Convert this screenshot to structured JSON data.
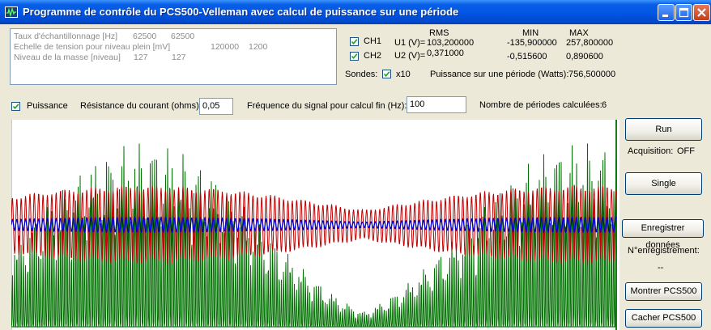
{
  "window": {
    "title": "Programme de contrôle du PCS500-Velleman avec calcul de puissance sur une période"
  },
  "info": {
    "rows": [
      {
        "label": "Taux d'échantillonnage [Hz]",
        "v1": "62500",
        "v2": "62500"
      },
      {
        "label": "Echelle de tension pour niveau plein [mV]",
        "v1": "120000",
        "v2": "1200"
      },
      {
        "label": "Niveau de la masse [niveau]",
        "v1": "127",
        "v2": "127"
      }
    ]
  },
  "measurements": {
    "headers": {
      "rms": "RMS",
      "min": "MIN",
      "max": "MAX"
    },
    "ch1": {
      "checkbox_label": "CH1",
      "label": "U1 (V)=",
      "rms": "103,200000",
      "min": "-135,900000",
      "max": "257,800000"
    },
    "ch2": {
      "checkbox_label": "CH2",
      "label": "U2 (V)=",
      "rms": "0,371000",
      "min": "-0,515600",
      "max": "0,890600"
    }
  },
  "probes": {
    "label": "Sondes:",
    "x10_label": "x10"
  },
  "power": {
    "label": "Puissance sur une période (Watts):",
    "value": "756,500000"
  },
  "params": {
    "puissance_label": "Puissance",
    "resistance_label": "Résistance du courant (ohms):",
    "resistance_value": "0,05",
    "freq_label": "Fréquence du signal pour calcul fin (Hz):",
    "freq_value": "100",
    "periods_label": "Nombre de périodes calculées:",
    "periods_value": "6"
  },
  "controls": {
    "run": "Run",
    "acquisition_label": "Acquisition:",
    "acquisition_value": "OFF",
    "single": "Single",
    "save": "Enregistrer données",
    "record_label": "N°enregistrement:",
    "record_value": "--",
    "show": "Montrer PCS500",
    "hide": "Cacher PCS500"
  },
  "colors": {
    "ch1": "#c00000",
    "ch2": "#0000cc",
    "power": "#007000",
    "title_bar": "#0055e5"
  }
}
